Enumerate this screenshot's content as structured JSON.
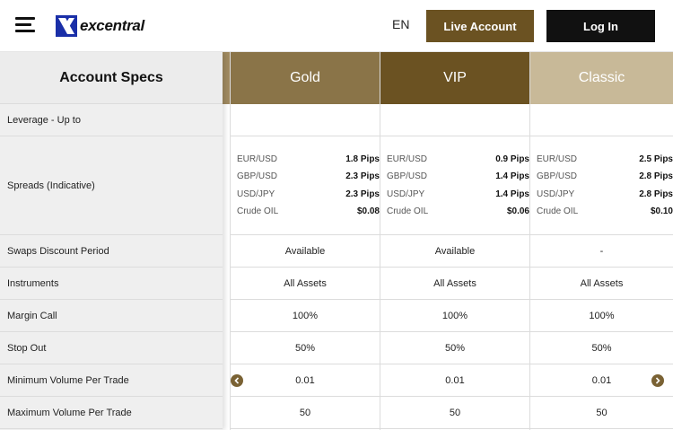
{
  "header": {
    "logo_text": "excentral",
    "language": "EN",
    "live_account_label": "Live Account",
    "login_label": "Log In"
  },
  "colors": {
    "gold": "#8a7448",
    "vip": "#6b5222",
    "classic": "#c8b998",
    "live_button": "#6b5222",
    "login_button": "#111111"
  },
  "specs": {
    "title": "Account Specs",
    "rows": [
      "Leverage - Up to",
      "Spreads (Indicative)",
      "Swaps Discount Period",
      "Instruments",
      "Margin Call",
      "Stop Out",
      "Minimum Volume Per Trade",
      "Maximum Volume Per Trade"
    ]
  },
  "plans": [
    {
      "name": "Gold",
      "leverage": "",
      "spreads": [
        {
          "pair": "EUR/USD",
          "value": "1.8 Pips"
        },
        {
          "pair": "GBP/USD",
          "value": "2.3 Pips"
        },
        {
          "pair": "USD/JPY",
          "value": "2.3 Pips"
        },
        {
          "pair": "Crude OIL",
          "value": "$0.08"
        }
      ],
      "swaps": "Available",
      "instruments": "All Assets",
      "margin_call": "100%",
      "stop_out": "50%",
      "min_volume": "0.01",
      "max_volume": "50"
    },
    {
      "name": "VIP",
      "leverage": "",
      "spreads": [
        {
          "pair": "EUR/USD",
          "value": "0.9 Pips"
        },
        {
          "pair": "GBP/USD",
          "value": "1.4 Pips"
        },
        {
          "pair": "USD/JPY",
          "value": "1.4 Pips"
        },
        {
          "pair": "Crude OIL",
          "value": "$0.06"
        }
      ],
      "swaps": "Available",
      "instruments": "All Assets",
      "margin_call": "100%",
      "stop_out": "50%",
      "min_volume": "0.01",
      "max_volume": "50"
    },
    {
      "name": "Classic",
      "leverage": "",
      "spreads": [
        {
          "pair": "EUR/USD",
          "value": "2.5 Pips"
        },
        {
          "pair": "GBP/USD",
          "value": "2.8 Pips"
        },
        {
          "pair": "USD/JPY",
          "value": "2.8 Pips"
        },
        {
          "pair": "Crude OIL",
          "value": "$0.10"
        }
      ],
      "swaps": "-",
      "instruments": "All Assets",
      "margin_call": "100%",
      "stop_out": "50%",
      "min_volume": "0.01",
      "max_volume": "50"
    }
  ]
}
